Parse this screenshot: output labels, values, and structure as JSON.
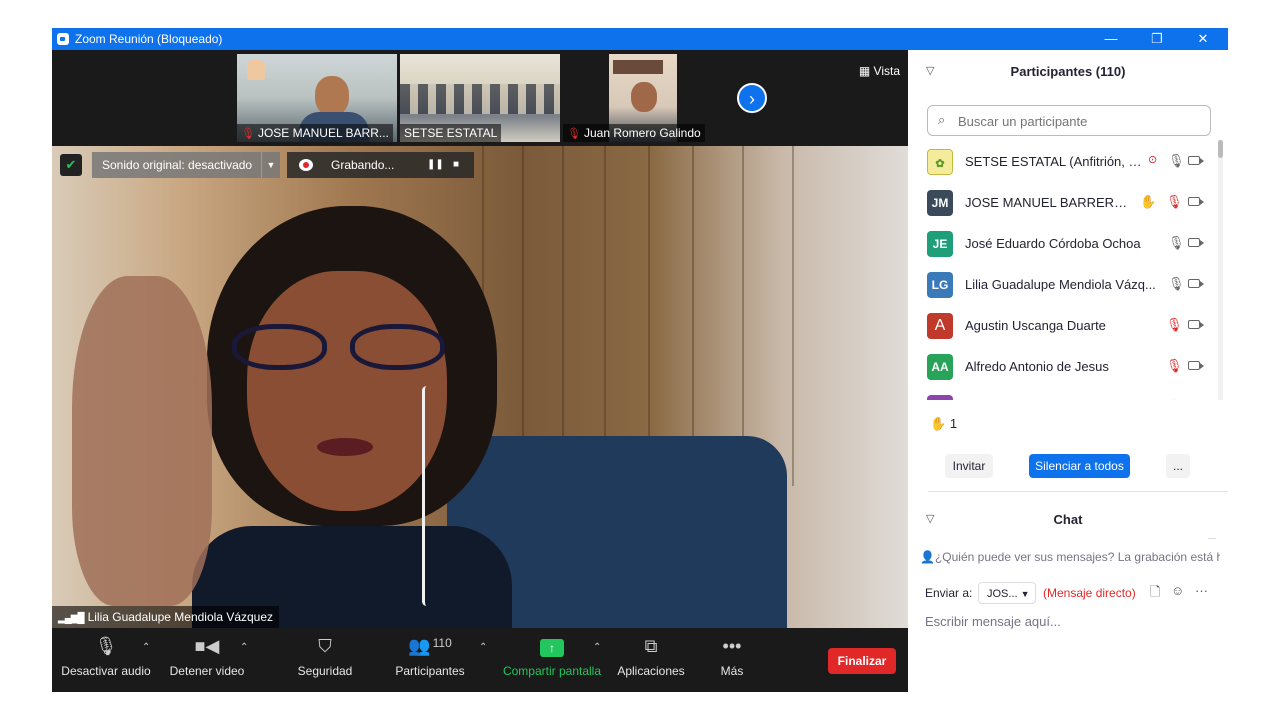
{
  "window": {
    "title": "Zoom Reunión (Bloqueado)",
    "minimize": "—",
    "restore": "❐",
    "close": "✕"
  },
  "strip": {
    "thumbs": [
      {
        "name": "JOSE MANUEL BARR..."
      },
      {
        "name": "SETSE ESTATAL"
      },
      {
        "name": "Juan Romero Galindo"
      }
    ],
    "view_label": "Vista"
  },
  "main_video": {
    "sound_label": "Sonido original: desactivado",
    "recording_label": "Grabando...",
    "speaker_name": "Lilia Guadalupe Mendiola Vázquez"
  },
  "toolbar": {
    "mute": "Desactivar audio",
    "video": "Detener video",
    "security": "Seguridad",
    "participants": "Participantes",
    "participants_count": "110",
    "share": "Compartir pantalla",
    "apps": "Aplicaciones",
    "more": "Más",
    "end": "Finalizar"
  },
  "participants_panel": {
    "title": "Participantes (110)",
    "search_placeholder": "Buscar un participante",
    "items": [
      {
        "initials": "",
        "name": "SETSE ESTATAL (Anfitrión, yo)",
        "color": "#e8e060"
      },
      {
        "initials": "JM",
        "name": "JOSE MANUEL BARRERA L...",
        "color": "#3a4a5a"
      },
      {
        "initials": "JE",
        "name": "José Eduardo Córdoba Ochoa",
        "color": "#1f9e7a"
      },
      {
        "initials": "LG",
        "name": "Lilia Guadalupe Mendiola Vázq...",
        "color": "#3a7ab8"
      },
      {
        "initials": "A",
        "name": "Agustin Uscanga Duarte",
        "color": "#c0392b"
      },
      {
        "initials": "AA",
        "name": "Alfredo Antonio de Jesus",
        "color": "#27a35a"
      },
      {
        "initials": "",
        "name": "",
        "color": "#8e44ad"
      }
    ],
    "raised_hands": "1",
    "invite": "Invitar",
    "mute_all": "Silenciar a todos",
    "more": "..."
  },
  "chat": {
    "title": "Chat",
    "notice": "¿Quién puede ver sus mensajes? La grabación está habilitada",
    "send_to_label": "Enviar a:",
    "send_to_value": "JOS...",
    "direct_label": "(Mensaje directo)",
    "input_placeholder": "Escribir mensaje aquí..."
  },
  "colors": {
    "accent": "#0e72ed",
    "end": "#e02828",
    "share": "#22c55e"
  }
}
